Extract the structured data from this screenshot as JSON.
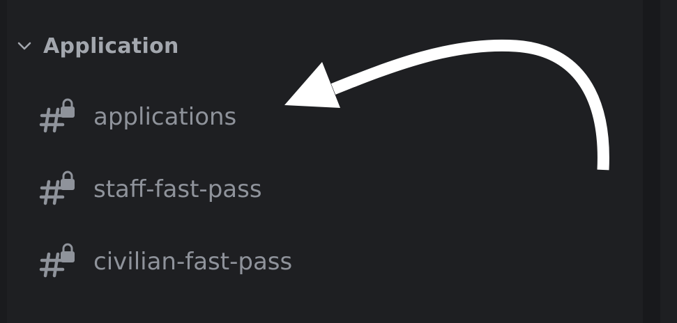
{
  "category": {
    "label": "Application",
    "icon": "chevron-down-icon",
    "collapsed": false
  },
  "channels": [
    {
      "name": "applications",
      "icon": "locked-text-channel-icon"
    },
    {
      "name": "staff-fast-pass",
      "icon": "locked-text-channel-icon"
    },
    {
      "name": "civilian-fast-pass",
      "icon": "locked-text-channel-icon"
    }
  ],
  "colors": {
    "background": "#1e1f22",
    "category_text": "#a3a7ae",
    "channel_text": "#8f939b",
    "annotation_arrow": "#ffffff"
  }
}
